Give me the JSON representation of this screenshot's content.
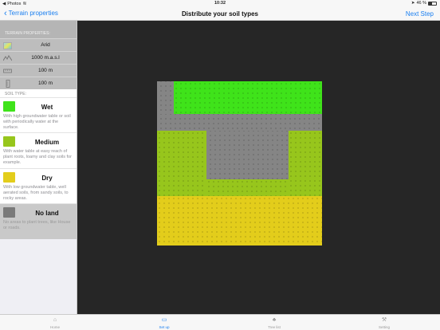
{
  "status_bar": {
    "carrier": "Photos",
    "time": "10:32",
    "battery": "46 %"
  },
  "nav": {
    "back_label": "Terrain properties",
    "title": "Distribute your soil types",
    "next_label": "Next Step"
  },
  "terrain_properties": {
    "header": "TERRAIN PROPERTIES:",
    "items": [
      {
        "icon": "climate-swatch-icon",
        "value": "Arid"
      },
      {
        "icon": "elevation-icon",
        "value": "1000 m.a.s.l"
      },
      {
        "icon": "width-ruler-icon",
        "value": "100 m"
      },
      {
        "icon": "length-ruler-icon",
        "value": "100 m"
      }
    ]
  },
  "soil_types": {
    "header": "SOIL TYPE:",
    "items": [
      {
        "name": "Wet",
        "color": "#3fe31a",
        "description": "With high groundwater table or soil with periodically water at the surface."
      },
      {
        "name": "Medium",
        "color": "#97c61c",
        "description": "With water table at easy reach of plant roots, loamy and clay soils for example."
      },
      {
        "name": "Dry",
        "color": "#e3cd1b",
        "description": "With low groundwater table, well aerated soils, from sandy soils, to rocky areas."
      },
      {
        "name": "No land",
        "color": "#7a7a7a",
        "description": "No areas to plant trees, like House or roads."
      }
    ]
  },
  "tabs": [
    {
      "label": "Home",
      "icon": "home-icon",
      "active": false
    },
    {
      "label": "Set up",
      "icon": "setup-icon",
      "active": true
    },
    {
      "label": "Tree list",
      "icon": "tree-list-icon",
      "active": false
    },
    {
      "label": "Setting",
      "icon": "wrench-icon",
      "active": false
    }
  ],
  "colors": {
    "accent": "#1a7ff0",
    "wet": "#3fe31a",
    "medium": "#97c61c",
    "dry": "#e3cd1b",
    "no_land": "#858585",
    "canvas_bg": "#262626"
  }
}
